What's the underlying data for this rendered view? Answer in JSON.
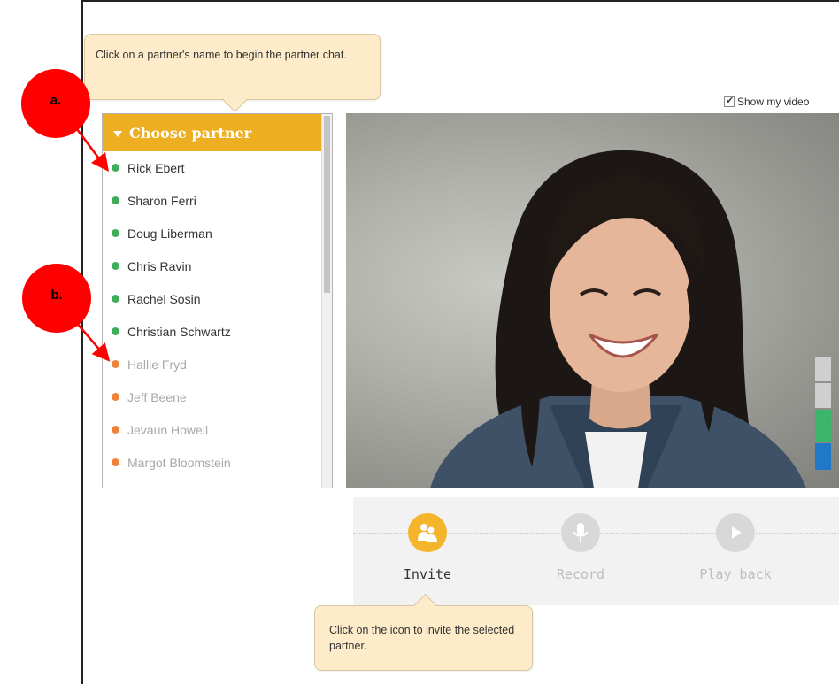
{
  "tooltips": {
    "partner_hint": "Click on a partner's name to begin the partner chat.",
    "invite_hint": "Click on the icon to invite the selected partner."
  },
  "markers": {
    "a": "a.",
    "b": "b."
  },
  "partner_panel": {
    "header": "Choose partner",
    "partners": [
      {
        "name": "Rick Ebert",
        "status": "online"
      },
      {
        "name": "Sharon Ferri",
        "status": "online"
      },
      {
        "name": "Doug Liberman",
        "status": "online"
      },
      {
        "name": "Chris Ravin",
        "status": "online"
      },
      {
        "name": "Rachel Sosin",
        "status": "online"
      },
      {
        "name": "Christian Schwartz",
        "status": "online"
      },
      {
        "name": "Hallie Fryd",
        "status": "offline"
      },
      {
        "name": "Jeff Beene",
        "status": "offline"
      },
      {
        "name": "Jevaun Howell",
        "status": "offline"
      },
      {
        "name": "Margot Bloomstein",
        "status": "offline"
      }
    ]
  },
  "video": {
    "show_my_video_label": "Show my video",
    "show_my_video_checked": true
  },
  "controls": {
    "invite_label": "Invite",
    "record_label": "Record",
    "playback_label": "Play back"
  },
  "colors": {
    "header_orange": "#eeae22",
    "online_green": "#3fae5a",
    "offline_orange": "#f0823a",
    "invite_yellow": "#f4b42c",
    "marker_red": "#ff0000"
  },
  "level_meter": [
    {
      "color": "#cfcfcf"
    },
    {
      "color": "#cfcfcf"
    },
    {
      "color": "#3ab56a"
    },
    {
      "color": "#1f78c8"
    }
  ]
}
